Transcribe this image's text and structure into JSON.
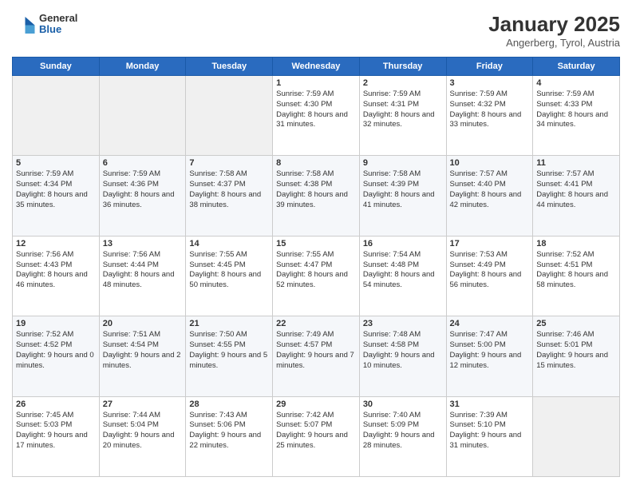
{
  "logo": {
    "general": "General",
    "blue": "Blue"
  },
  "title": "January 2025",
  "subtitle": "Angerberg, Tyrol, Austria",
  "days": [
    "Sunday",
    "Monday",
    "Tuesday",
    "Wednesday",
    "Thursday",
    "Friday",
    "Saturday"
  ],
  "weeks": [
    [
      {
        "num": "",
        "text": ""
      },
      {
        "num": "",
        "text": ""
      },
      {
        "num": "",
        "text": ""
      },
      {
        "num": "1",
        "text": "Sunrise: 7:59 AM\nSunset: 4:30 PM\nDaylight: 8 hours and 31 minutes."
      },
      {
        "num": "2",
        "text": "Sunrise: 7:59 AM\nSunset: 4:31 PM\nDaylight: 8 hours and 32 minutes."
      },
      {
        "num": "3",
        "text": "Sunrise: 7:59 AM\nSunset: 4:32 PM\nDaylight: 8 hours and 33 minutes."
      },
      {
        "num": "4",
        "text": "Sunrise: 7:59 AM\nSunset: 4:33 PM\nDaylight: 8 hours and 34 minutes."
      }
    ],
    [
      {
        "num": "5",
        "text": "Sunrise: 7:59 AM\nSunset: 4:34 PM\nDaylight: 8 hours and 35 minutes."
      },
      {
        "num": "6",
        "text": "Sunrise: 7:59 AM\nSunset: 4:36 PM\nDaylight: 8 hours and 36 minutes."
      },
      {
        "num": "7",
        "text": "Sunrise: 7:58 AM\nSunset: 4:37 PM\nDaylight: 8 hours and 38 minutes."
      },
      {
        "num": "8",
        "text": "Sunrise: 7:58 AM\nSunset: 4:38 PM\nDaylight: 8 hours and 39 minutes."
      },
      {
        "num": "9",
        "text": "Sunrise: 7:58 AM\nSunset: 4:39 PM\nDaylight: 8 hours and 41 minutes."
      },
      {
        "num": "10",
        "text": "Sunrise: 7:57 AM\nSunset: 4:40 PM\nDaylight: 8 hours and 42 minutes."
      },
      {
        "num": "11",
        "text": "Sunrise: 7:57 AM\nSunset: 4:41 PM\nDaylight: 8 hours and 44 minutes."
      }
    ],
    [
      {
        "num": "12",
        "text": "Sunrise: 7:56 AM\nSunset: 4:43 PM\nDaylight: 8 hours and 46 minutes."
      },
      {
        "num": "13",
        "text": "Sunrise: 7:56 AM\nSunset: 4:44 PM\nDaylight: 8 hours and 48 minutes."
      },
      {
        "num": "14",
        "text": "Sunrise: 7:55 AM\nSunset: 4:45 PM\nDaylight: 8 hours and 50 minutes."
      },
      {
        "num": "15",
        "text": "Sunrise: 7:55 AM\nSunset: 4:47 PM\nDaylight: 8 hours and 52 minutes."
      },
      {
        "num": "16",
        "text": "Sunrise: 7:54 AM\nSunset: 4:48 PM\nDaylight: 8 hours and 54 minutes."
      },
      {
        "num": "17",
        "text": "Sunrise: 7:53 AM\nSunset: 4:49 PM\nDaylight: 8 hours and 56 minutes."
      },
      {
        "num": "18",
        "text": "Sunrise: 7:52 AM\nSunset: 4:51 PM\nDaylight: 8 hours and 58 minutes."
      }
    ],
    [
      {
        "num": "19",
        "text": "Sunrise: 7:52 AM\nSunset: 4:52 PM\nDaylight: 9 hours and 0 minutes."
      },
      {
        "num": "20",
        "text": "Sunrise: 7:51 AM\nSunset: 4:54 PM\nDaylight: 9 hours and 2 minutes."
      },
      {
        "num": "21",
        "text": "Sunrise: 7:50 AM\nSunset: 4:55 PM\nDaylight: 9 hours and 5 minutes."
      },
      {
        "num": "22",
        "text": "Sunrise: 7:49 AM\nSunset: 4:57 PM\nDaylight: 9 hours and 7 minutes."
      },
      {
        "num": "23",
        "text": "Sunrise: 7:48 AM\nSunset: 4:58 PM\nDaylight: 9 hours and 10 minutes."
      },
      {
        "num": "24",
        "text": "Sunrise: 7:47 AM\nSunset: 5:00 PM\nDaylight: 9 hours and 12 minutes."
      },
      {
        "num": "25",
        "text": "Sunrise: 7:46 AM\nSunset: 5:01 PM\nDaylight: 9 hours and 15 minutes."
      }
    ],
    [
      {
        "num": "26",
        "text": "Sunrise: 7:45 AM\nSunset: 5:03 PM\nDaylight: 9 hours and 17 minutes."
      },
      {
        "num": "27",
        "text": "Sunrise: 7:44 AM\nSunset: 5:04 PM\nDaylight: 9 hours and 20 minutes."
      },
      {
        "num": "28",
        "text": "Sunrise: 7:43 AM\nSunset: 5:06 PM\nDaylight: 9 hours and 22 minutes."
      },
      {
        "num": "29",
        "text": "Sunrise: 7:42 AM\nSunset: 5:07 PM\nDaylight: 9 hours and 25 minutes."
      },
      {
        "num": "30",
        "text": "Sunrise: 7:40 AM\nSunset: 5:09 PM\nDaylight: 9 hours and 28 minutes."
      },
      {
        "num": "31",
        "text": "Sunrise: 7:39 AM\nSunset: 5:10 PM\nDaylight: 9 hours and 31 minutes."
      },
      {
        "num": "",
        "text": ""
      }
    ]
  ]
}
